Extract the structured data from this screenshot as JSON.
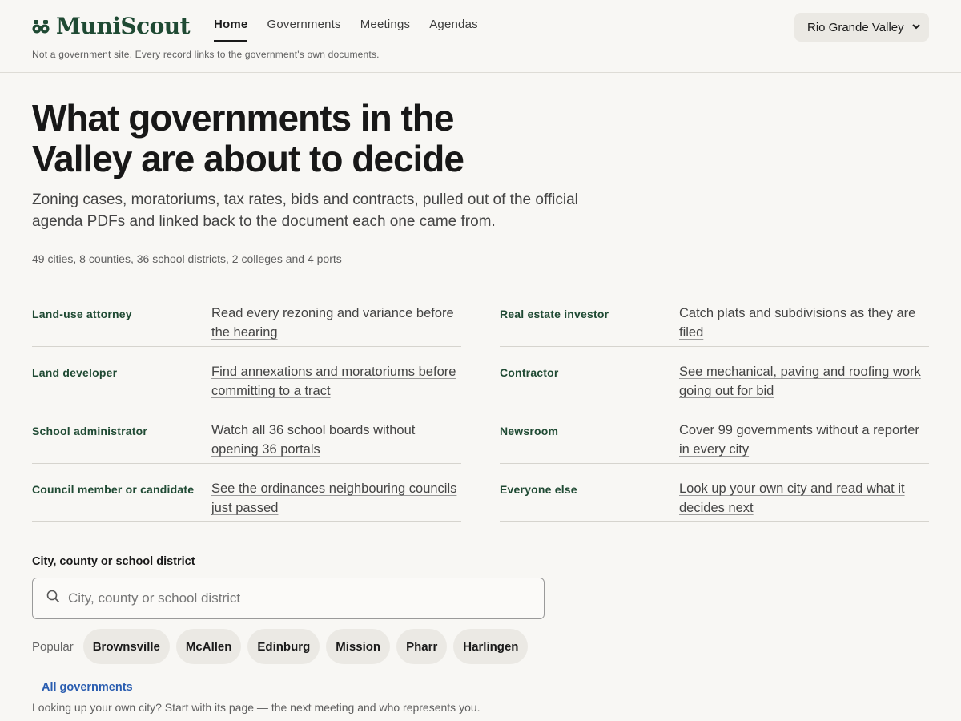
{
  "brand": {
    "name": "MuniScout",
    "logo_icon": "binoculars-icon",
    "color": "#1f4a33"
  },
  "nav": [
    {
      "label": "Home",
      "active": true
    },
    {
      "label": "Governments",
      "active": false
    },
    {
      "label": "Meetings",
      "active": false
    },
    {
      "label": "Agendas",
      "active": false
    }
  ],
  "region_select": {
    "value": "Rio Grande Valley",
    "icon": "chevron-down-icon"
  },
  "disclaimer": "Not a government site. Every record links to the government's own documents.",
  "hero": {
    "title_line1": "What governments in the",
    "title_line2": "Valley are about to decide",
    "lede": "Zoning cases, moratoriums, tax rates, bids and contracts, pulled out of the official agenda PDFs and linked back to the document each one came from.",
    "stats": "49 cities, 8 counties, 36 school districts, 2 colleges and 4 ports"
  },
  "audiences_left": [
    {
      "role": "Land-use attorney",
      "link": "Read every rezoning and variance before the hearing"
    },
    {
      "role": "Land developer",
      "link": "Find annexations and moratoriums before committing to a tract"
    },
    {
      "role": "School administrator",
      "link": "Watch all 36 school boards without opening 36 portals"
    },
    {
      "role": "Council member or candidate",
      "link": "See the ordinances neighbouring councils just passed"
    }
  ],
  "audiences_right": [
    {
      "role": "Real estate investor",
      "link": "Catch plats and subdivisions as they are filed"
    },
    {
      "role": "Contractor",
      "link": "See mechanical, paving and roofing work going out for bid"
    },
    {
      "role": "Newsroom",
      "link": "Cover 99 governments without a reporter in every city"
    },
    {
      "role": "Everyone else",
      "link": "Look up your own city and read what it decides next"
    }
  ],
  "search": {
    "label": "City, county or school district",
    "placeholder": "City, county or school district",
    "value": "",
    "icon": "search-icon"
  },
  "popular": {
    "label": "Popular",
    "chips": [
      "Brownsville",
      "McAllen",
      "Edinburg",
      "Mission",
      "Pharr",
      "Harlingen"
    ]
  },
  "all_governments_link": "All governments",
  "footnote": "Looking up your own city? Start with its page — the next meeting and who represents you.",
  "colors": {
    "background": "#f8f7f4",
    "accent_green": "#1f4a33",
    "link_blue": "#2a5db0",
    "chip_bg": "#ebe9e4"
  }
}
